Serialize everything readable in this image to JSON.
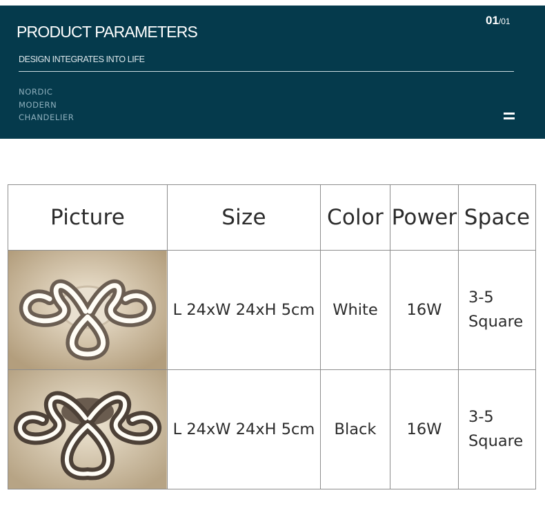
{
  "banner": {
    "title": "PRODUCT PARAMETERS",
    "subtitle": "DESIGN INTEGRATES INTO LIFE",
    "tags": [
      "NORDIC",
      "MODERN",
      "CHANDELIER"
    ],
    "page_current": "01",
    "page_total": "/01",
    "bg_color": "#053a4c"
  },
  "table": {
    "headers": [
      "Picture",
      "Size",
      "Color",
      "Power",
      "Space"
    ],
    "rows": [
      {
        "size": "L 24xW 24xH 5cm",
        "color": "White",
        "power": "16W",
        "space_line1": "3-5",
        "space_line2": "Square",
        "finish": "#ffffff"
      },
      {
        "size": "L 24xW 24xH 5cm",
        "color": "Black",
        "power": "16W",
        "space_line1": "3-5",
        "space_line2": "Square",
        "finish": "#5a4f45"
      }
    ]
  }
}
